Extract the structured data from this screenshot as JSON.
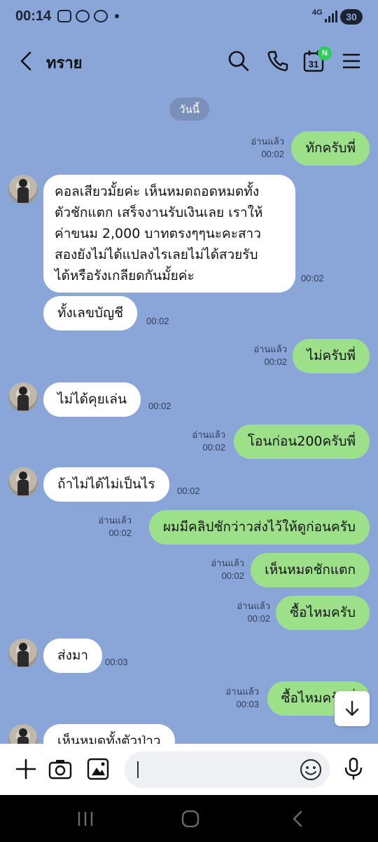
{
  "status_bar": {
    "time": "00:14",
    "network": "4G",
    "battery": "30",
    "icons": [
      "screen-record-icon",
      "messenger-icon",
      "line-icon"
    ]
  },
  "header": {
    "title": "ทราย",
    "calendar_day": "31",
    "calendar_badge": "N",
    "icons": [
      "back-arrow-icon",
      "search-icon",
      "phone-icon",
      "calendar-icon",
      "menu-icon"
    ]
  },
  "chat": {
    "date_label": "วันนี้",
    "messages": [
      {
        "dir": "out",
        "text": "ทักครับพี่",
        "read": "อ่านแล้ว",
        "time": "00:02"
      },
      {
        "dir": "in",
        "lines": [
          "คอลเสียวมั้ยค่ะ เห็นหมดถอดหมดทั้ง",
          "ตัวชักแตก เสร็จงานรับเงินเลย เราให้",
          "ค่าขนม 2,000 บาทตรงๆๆนะคะสาว",
          "สองยังไม่ได้แปลงไรเลยไม่ได้สวยรับ",
          "ได้หรือรังเกลียดกันมั้ยค่ะ"
        ],
        "time": "00:02"
      },
      {
        "dir": "in",
        "text": "ทั้งเลขบัญชี",
        "time": "00:02"
      },
      {
        "dir": "out",
        "text": "ไม่ครับพี่",
        "read": "อ่านแล้ว",
        "time": "00:02"
      },
      {
        "dir": "in",
        "text": "ไม่ได้คุยเล่น",
        "time": "00:02"
      },
      {
        "dir": "out",
        "text": "โอนก่อน200ครับพี่",
        "read": "อ่านแล้ว",
        "time": "00:02"
      },
      {
        "dir": "in",
        "text": "ถ้าไม่ได้ไม่เป็นไร",
        "time": "00:02"
      },
      {
        "dir": "out",
        "text": "ผมมีคลิปชักว่าวส่งไว้ให้ดูก่อนครับ",
        "read": "อ่านแล้ว",
        "time": "00:02"
      },
      {
        "dir": "out",
        "text": "เห็นหมดชักแตก",
        "read": "อ่านแล้ว",
        "time": "00:02"
      },
      {
        "dir": "out",
        "text": "ซื้อไหมครับ",
        "read": "อ่านแล้ว",
        "time": "00:02"
      },
      {
        "dir": "in",
        "text": "ส่งมา",
        "time": "00:03"
      },
      {
        "dir": "out",
        "text": "ซื้อไหมครับพี่",
        "read": "อ่านแล้ว",
        "time": "00:03"
      },
      {
        "dir": "in",
        "text": "เห็นหมดทั้งตัวป่าว",
        "time": ""
      }
    ]
  },
  "input_bar": {
    "placeholder": "",
    "icons": [
      "plus-icon",
      "camera-icon",
      "image-icon",
      "emoji-icon",
      "mic-icon"
    ]
  },
  "nav_bar": {
    "icons": [
      "recent-apps-icon",
      "home-icon",
      "back-icon"
    ]
  },
  "colors": {
    "chat_background": "#8aa6d9",
    "outgoing_bubble": "#9de08a",
    "incoming_bubble": "#ffffff",
    "badge_green": "#2ecc5b"
  }
}
